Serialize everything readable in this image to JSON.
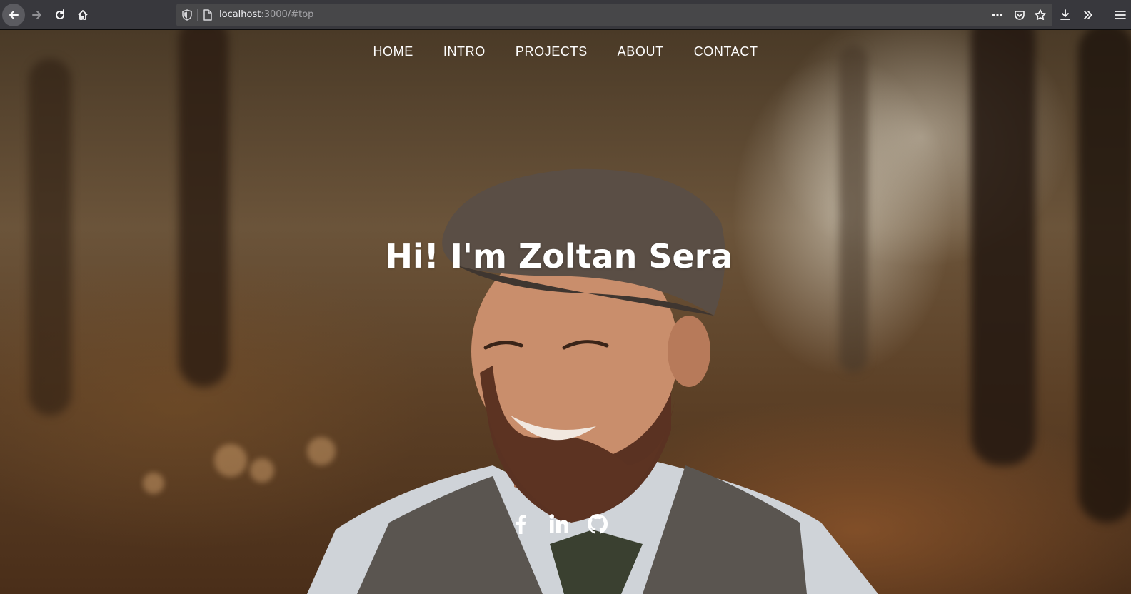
{
  "browser": {
    "url_host": "localhost",
    "url_rest": ":3000/#top",
    "icons": {
      "back": "arrow-left-icon",
      "forward": "arrow-right-icon",
      "reload": "reload-icon",
      "home": "home-icon",
      "tracking": "shield-icon",
      "page": "page-icon",
      "page_actions": "more-horizontal-icon",
      "pocket": "pocket-icon",
      "bookmark": "star-icon",
      "downloads": "download-icon",
      "overflow": "double-chevron-right-icon",
      "menu": "hamburger-icon"
    }
  },
  "nav": {
    "items": [
      {
        "label": "HOME"
      },
      {
        "label": "INTRO"
      },
      {
        "label": "PROJECTS"
      },
      {
        "label": "ABOUT"
      },
      {
        "label": "CONTACT"
      }
    ]
  },
  "hero": {
    "title": "Hi! I'm Zoltan Sera"
  },
  "social": {
    "icons": [
      "facebook-icon",
      "linkedin-icon",
      "github-icon"
    ]
  },
  "colors": {
    "toolbar": "#38383d",
    "urlbar": "#474749",
    "text_light": "#ffffff"
  }
}
